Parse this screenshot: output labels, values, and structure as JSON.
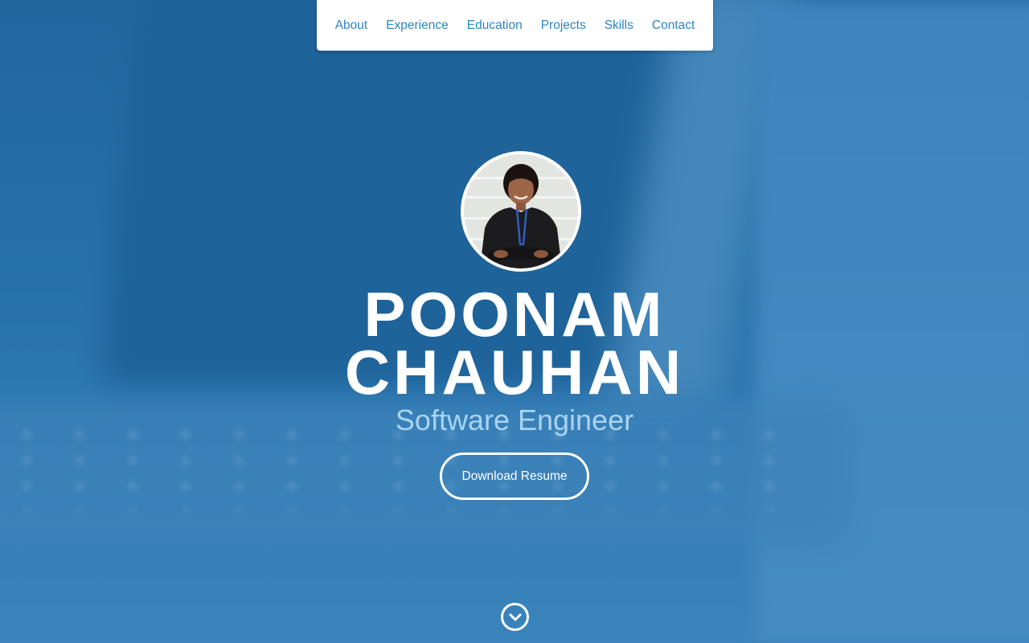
{
  "nav": {
    "items": [
      {
        "label": "About"
      },
      {
        "label": "Experience"
      },
      {
        "label": "Education"
      },
      {
        "label": "Projects"
      },
      {
        "label": "Skills"
      },
      {
        "label": "Contact"
      }
    ]
  },
  "profile": {
    "first_name": "POONAM",
    "last_name": "CHAUHAN",
    "role": "Software Engineer",
    "resume_button": "Download Resume"
  },
  "icons": {
    "scroll": "chevron-down-circle-icon"
  },
  "colors": {
    "nav_link": "#2c86c2",
    "hero_blue": "#2f78ae",
    "role_text": "#a9d3f2"
  }
}
